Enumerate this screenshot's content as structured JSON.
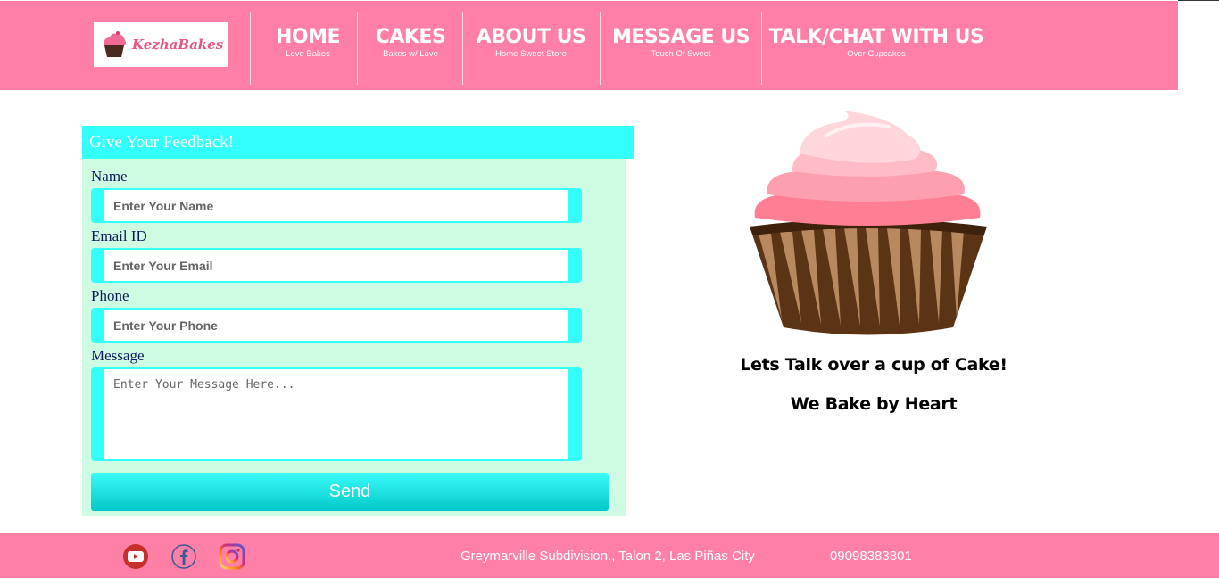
{
  "brand": {
    "logo_text": "KezhaBakes",
    "primary_color": "#ff7fa6",
    "accent_color": "#33ffff"
  },
  "nav": [
    {
      "title": "HOME",
      "subtitle": "Love Bakes"
    },
    {
      "title": "CAKES",
      "subtitle": "Bakes w/ Love"
    },
    {
      "title": "ABOUT US",
      "subtitle": "Home Sweet Store"
    },
    {
      "title": "MESSAGE US",
      "subtitle": "Touch Of Sweet"
    },
    {
      "title": "TALK/CHAT WITH US",
      "subtitle": "Over Cupcakes"
    }
  ],
  "form": {
    "heading": "Give Your Feedback!",
    "name_label": "Name",
    "name_placeholder": "Enter Your Name",
    "email_label": "Email ID",
    "email_placeholder": "Enter Your Email",
    "phone_label": "Phone",
    "phone_placeholder": "Enter Your Phone",
    "message_label": "Message",
    "message_placeholder": "Enter Your Message Here...",
    "send_label": "Send"
  },
  "side": {
    "line1": "Lets Talk over a cup of Cake!",
    "line2": "We Bake by Heart"
  },
  "footer": {
    "social": [
      "youtube-icon",
      "facebook-icon",
      "instagram-icon"
    ],
    "address": "Greymarville Subdivision., Talon 2, Las Piñas City",
    "phone": "09098383801"
  }
}
